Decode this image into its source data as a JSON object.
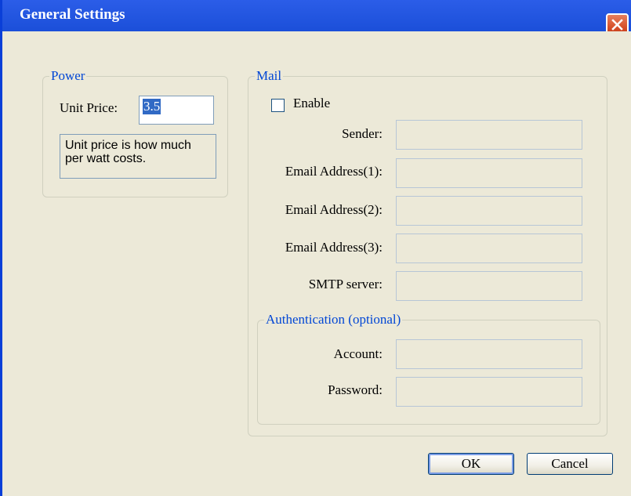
{
  "window": {
    "title": "General Settings"
  },
  "power": {
    "legend": "Power",
    "unit_price_label": "Unit Price:",
    "unit_price_value": "3.5",
    "hint": "Unit price is how much per watt costs."
  },
  "mail": {
    "legend": "Mail",
    "enable_label": "Enable",
    "enabled": false,
    "fields": {
      "sender_label": "Sender:",
      "email1_label": "Email Address(1):",
      "email2_label": "Email Address(2):",
      "email3_label": "Email Address(3):",
      "smtp_label": "SMTP server:"
    },
    "auth": {
      "legend": "Authentication (optional)",
      "account_label": "Account:",
      "password_label": "Password:"
    }
  },
  "buttons": {
    "ok": "OK",
    "cancel": "Cancel"
  },
  "colors": {
    "titlebar": "#1b4fd9",
    "dialog_bg": "#ece9d8",
    "legend_text": "#0046d5",
    "selection": "#316ac5",
    "close_button": "#d8522c"
  },
  "icons": {
    "close": "close-x-icon",
    "checkbox": "checkbox-unchecked"
  }
}
